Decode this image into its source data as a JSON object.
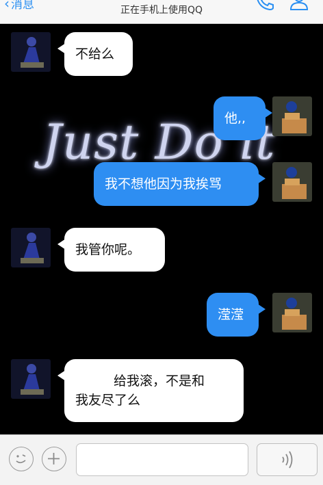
{
  "header": {
    "back_label": "消息",
    "subtitle": "正在手机上使用QQ"
  },
  "background_text": "Just Do it",
  "messages": [
    {
      "side": "them",
      "text": "不给么"
    },
    {
      "side": "me",
      "text": "他,,"
    },
    {
      "side": "me",
      "text": "我不想他因为我挨骂"
    },
    {
      "side": "them",
      "text": "我管你呢。"
    },
    {
      "side": "me",
      "text": "滢滢"
    },
    {
      "side": "them",
      "line1": "给我滚，不是和",
      "line2": "我友尽了么"
    }
  ],
  "input": {
    "placeholder": "",
    "value": ""
  },
  "colors": {
    "accent": "#2e8ef2",
    "bubble_them": "#ffffff",
    "bubble_me": "#2e8ef2"
  }
}
